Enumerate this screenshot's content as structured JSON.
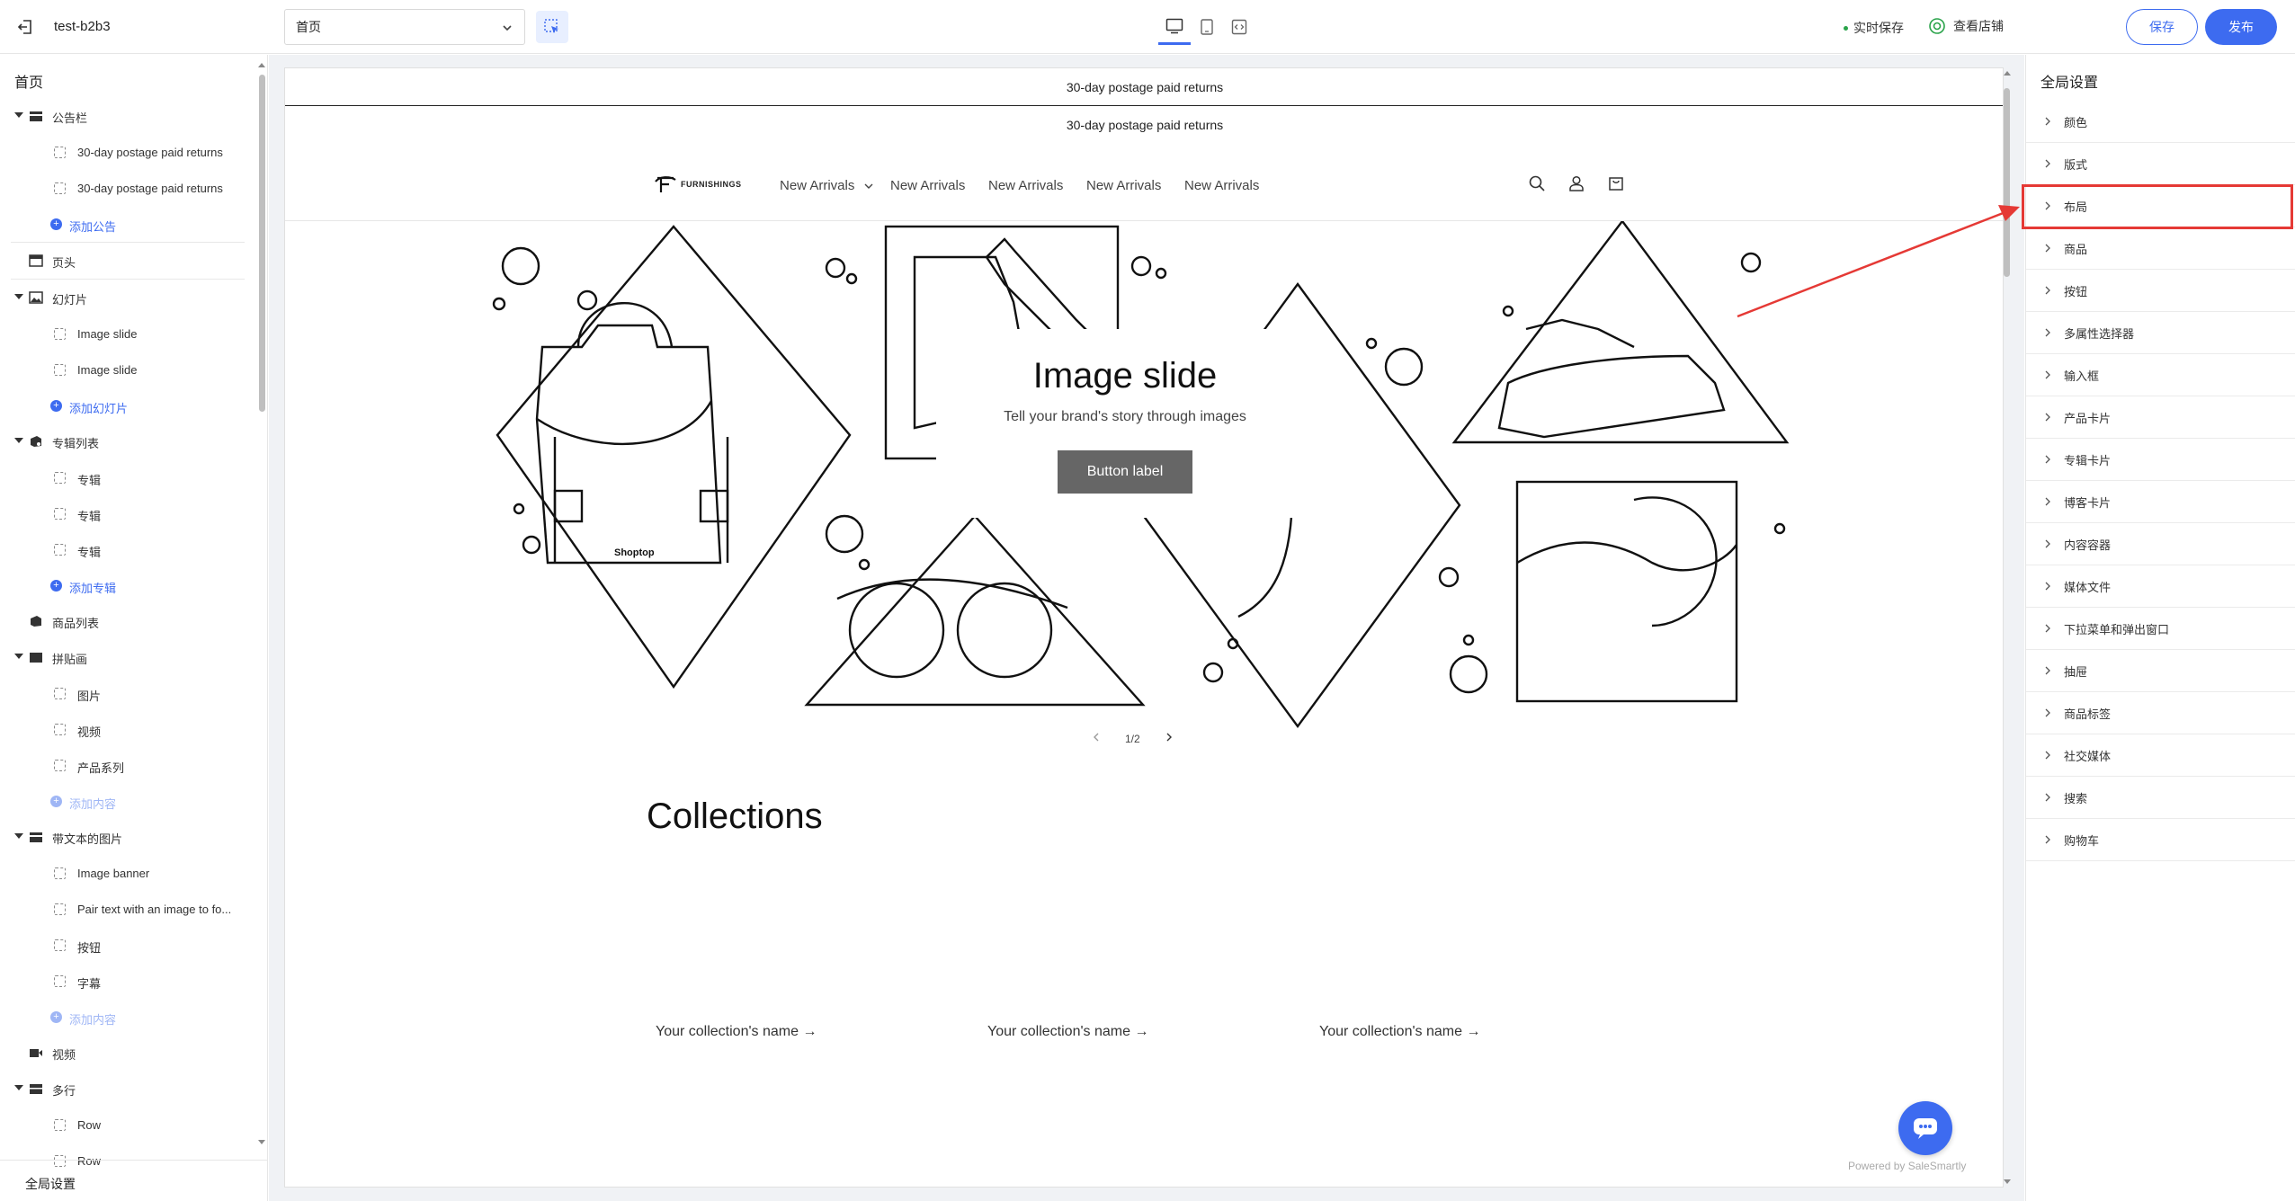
{
  "topbar": {
    "store_name": "test-b2b3",
    "page_select": "首页",
    "autosave": "实时保存",
    "view_store": "查看店铺",
    "save": "保存",
    "publish": "发布"
  },
  "left": {
    "title": "首页",
    "tree": [
      {
        "type": "parent",
        "icon": "folder-icon",
        "label": "公告栏",
        "expanded": true
      },
      {
        "type": "child",
        "label": "30-day postage paid returns"
      },
      {
        "type": "child",
        "label": "30-day postage paid returns"
      },
      {
        "type": "add",
        "label": "添加公告"
      },
      {
        "type": "sep"
      },
      {
        "type": "parent",
        "icon": "header-icon",
        "label": "页头",
        "expanded": false
      },
      {
        "type": "sep"
      },
      {
        "type": "parent",
        "icon": "image-icon",
        "label": "幻灯片",
        "expanded": true
      },
      {
        "type": "child",
        "label": "Image slide"
      },
      {
        "type": "child",
        "label": "Image slide"
      },
      {
        "type": "add",
        "label": "添加幻灯片"
      },
      {
        "type": "parent",
        "icon": "collection-icon",
        "label": "专辑列表",
        "expanded": true
      },
      {
        "type": "child",
        "label": "专辑"
      },
      {
        "type": "child",
        "label": "专辑"
      },
      {
        "type": "child",
        "label": "专辑"
      },
      {
        "type": "add",
        "label": "添加专辑"
      },
      {
        "type": "parent",
        "icon": "product-list-icon",
        "label": "商品列表",
        "expanded": false
      },
      {
        "type": "parent",
        "icon": "collage-icon",
        "label": "拼贴画",
        "expanded": true
      },
      {
        "type": "child",
        "label": "图片"
      },
      {
        "type": "child",
        "label": "视频"
      },
      {
        "type": "child",
        "label": "产品系列"
      },
      {
        "type": "add",
        "label": "添加内容",
        "disabled": true
      },
      {
        "type": "parent",
        "icon": "image-text-icon",
        "label": "带文本的图片",
        "expanded": true
      },
      {
        "type": "child",
        "label": "Image banner"
      },
      {
        "type": "child",
        "label": "Pair text with an image to fo..."
      },
      {
        "type": "child",
        "label": "按钮"
      },
      {
        "type": "child",
        "label": "字幕"
      },
      {
        "type": "add",
        "label": "添加内容",
        "disabled": true
      },
      {
        "type": "parent",
        "icon": "video-icon",
        "label": "视频",
        "expanded": false
      },
      {
        "type": "parent",
        "icon": "multirow-icon",
        "label": "多行",
        "expanded": true
      },
      {
        "type": "child",
        "label": "Row"
      },
      {
        "type": "child",
        "label": "Row"
      }
    ],
    "footer": "全局设置"
  },
  "preview": {
    "announcement_1": "30-day postage paid returns",
    "announcement_2": "30-day postage paid returns",
    "logo": "FURNISHINGS",
    "nav": [
      "New Arrivals",
      "New Arrivals",
      "New Arrivals",
      "New Arrivals",
      "New Arrivals"
    ],
    "slide": {
      "title": "Image slide",
      "subtitle": "Tell your brand's story through images",
      "button": "Button label",
      "counter": "1/2",
      "bag_brand": "Shoptop"
    },
    "collections": {
      "title": "Collections",
      "items": [
        "Your collection's name →",
        "Your collection's name →",
        "Your collection's name →"
      ]
    },
    "powered_by": "Powered by SaleSmartly"
  },
  "right": {
    "title": "全局设置",
    "items": [
      "颜色",
      "版式",
      "布局",
      "商品",
      "按钮",
      "多属性选择器",
      "输入框",
      "产品卡片",
      "专辑卡片",
      "博客卡片",
      "内容容器",
      "媒体文件",
      "下拉菜单和弹出窗口",
      "抽屉",
      "商品标签",
      "社交媒体",
      "搜索",
      "购物车"
    ],
    "highlighted": "布局"
  },
  "colors": {
    "accent": "#3d6bf0",
    "annotation": "#e53935"
  }
}
